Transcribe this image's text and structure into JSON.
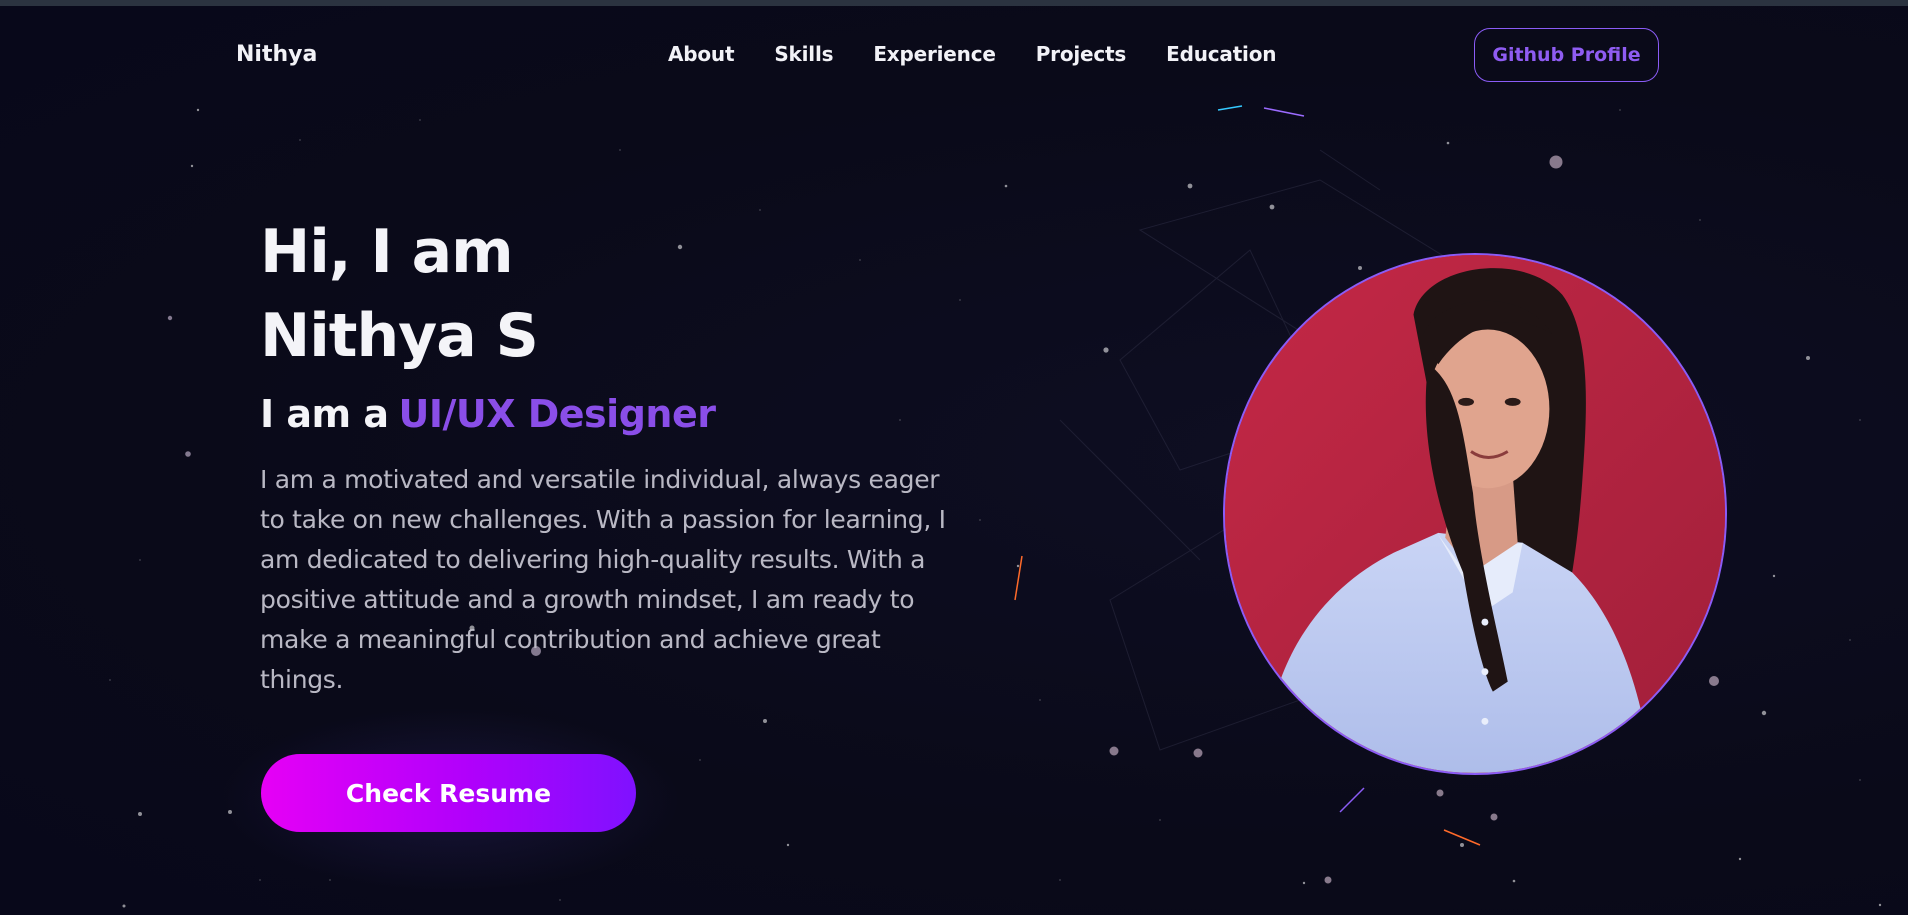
{
  "nav": {
    "brand": "Nithya",
    "links": [
      "About",
      "Skills",
      "Experience",
      "Projects",
      "Education"
    ],
    "github_label": "Github Profile"
  },
  "hero": {
    "greeting": "Hi, I am",
    "name": "Nithya S",
    "role_prefix": "I am a",
    "role": "UI/UX Designer",
    "bio": "I am a motivated and versatile individual, always eager to take on new challenges. With a passion for learning, I am dedicated to delivering high-quality results. With a positive attitude and a growth mindset, I am ready to make a meaningful contribution and achieve great things.",
    "resume_label": "Check Resume"
  },
  "colors": {
    "background": "#0a0a19",
    "accent": "#8a4ee8",
    "button_gradient_start": "#e600f6",
    "button_gradient_end": "#7f11ff"
  },
  "icons": {
    "portrait": "profile-photo"
  }
}
